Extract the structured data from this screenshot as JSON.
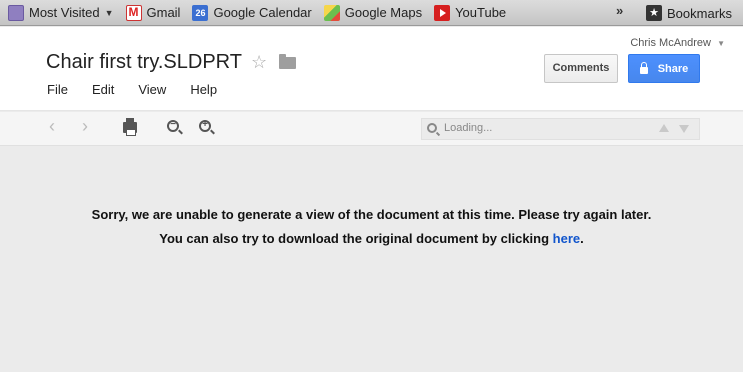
{
  "bookmarks": {
    "items": [
      {
        "label": "Most Visited",
        "icon": "folder-icon"
      },
      {
        "label": "Gmail",
        "icon": "gmail-icon"
      },
      {
        "label": "Google Calendar",
        "icon": "calendar-icon",
        "icon_text": "26"
      },
      {
        "label": "Google Maps",
        "icon": "maps-icon"
      },
      {
        "label": "YouTube",
        "icon": "youtube-icon"
      }
    ],
    "overflow": "»",
    "bookmarks_label": "Bookmarks"
  },
  "header": {
    "user": "Chris McAndrew",
    "title": "Chair first try.SLDPRT",
    "menu": [
      "File",
      "Edit",
      "View",
      "Help"
    ],
    "comments_label": "Comments",
    "share_label": "Share"
  },
  "toolbar": {
    "search_placeholder": "Loading..."
  },
  "message": {
    "line1": "Sorry, we are unable to generate a view of the document at this time. Please try again later.",
    "line2_prefix": "You can also try to download the original document by clicking ",
    "line2_link": "here",
    "line2_suffix": "."
  },
  "colors": {
    "accent": "#4d90fe",
    "link": "#1155cc",
    "background": "#ebebeb"
  }
}
